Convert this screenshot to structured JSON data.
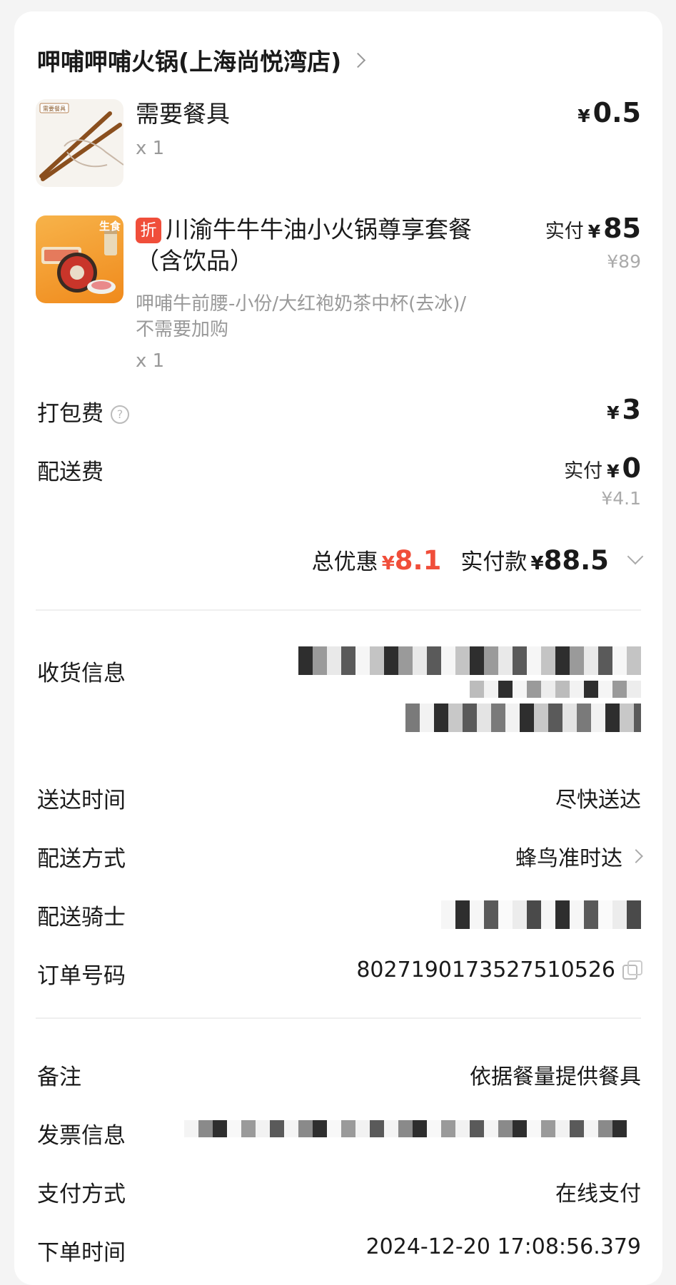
{
  "store": {
    "name": "呷哺呷哺火锅(上海尚悦湾店)"
  },
  "items": [
    {
      "name": "需要餐具",
      "qty": "x 1",
      "price_symbol": "¥",
      "price": "0.5",
      "thumb_label": "需要餐具"
    },
    {
      "tag": "折",
      "name": "川渝牛牛牛油小火锅尊享套餐（含饮品）",
      "spec": "呷哺牛前腰-小份/大红袍奶茶中杯(去冰)/不需要加购",
      "qty": "x 1",
      "price_prefix": "实付",
      "price_symbol": "¥",
      "price": "85",
      "original_price": "¥89",
      "thumb_badge": "生食"
    }
  ],
  "fees": {
    "packing_label": "打包费",
    "packing_symbol": "¥",
    "packing_value": "3",
    "delivery_label": "配送费",
    "delivery_prefix": "实付",
    "delivery_symbol": "¥",
    "delivery_value": "0",
    "delivery_original": "¥4.1"
  },
  "summary": {
    "discount_label": "总优惠",
    "discount_symbol": "¥",
    "discount_value": "8.1",
    "paid_label": "实付款",
    "paid_symbol": "¥",
    "paid_value": "88.5"
  },
  "info": {
    "address_label": "收货信息",
    "arrival_label": "送达时间",
    "arrival_value": "尽快送达",
    "method_label": "配送方式",
    "method_value": "蜂鸟准时达",
    "rider_label": "配送骑士",
    "order_no_label": "订单号码",
    "order_no_value": "8027190173527510526"
  },
  "extra": {
    "remark_label": "备注",
    "remark_value": "依据餐量提供餐具",
    "invoice_label": "发票信息",
    "payment_label": "支付方式",
    "payment_value": "在线支付",
    "time_label": "下单时间",
    "time_value": "2024-12-20 17:08:56.379"
  },
  "colors": {
    "accent_red": "#f04e3a",
    "muted": "#999999"
  },
  "icons": [
    "chevron-right-icon",
    "help-icon",
    "copy-icon",
    "chevron-down-icon"
  ]
}
